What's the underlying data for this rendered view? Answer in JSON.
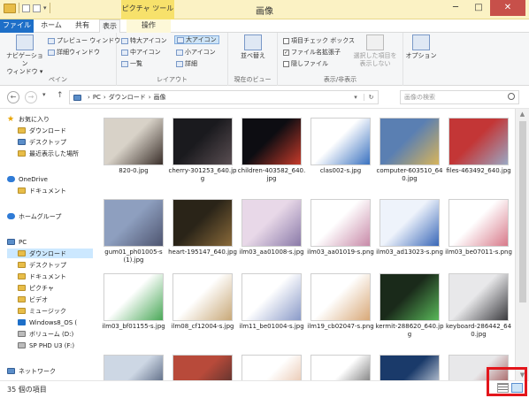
{
  "window": {
    "title": "画像",
    "context_tab_title": "ピクチャ ツール",
    "minimize": "─",
    "maximize": "□",
    "close": "✕"
  },
  "tabs": {
    "file": "ファイル",
    "home": "ホーム",
    "share": "共有",
    "view": "表示",
    "manage": "操作"
  },
  "ribbon": {
    "pane": {
      "navigation_pane": "ナビゲーション",
      "navigation_pane2": "ウィンドウ ▾",
      "preview_pane": "プレビュー ウィンドウ",
      "details_pane": "詳細ウィンドウ",
      "label": "ペイン"
    },
    "layout": {
      "extra_large": "特大アイコン",
      "large": "大アイコン",
      "medium": "中アイコン",
      "small": "小アイコン",
      "list": "一覧",
      "details": "詳細",
      "label": "レイアウト"
    },
    "current_view": {
      "sort": "並べ替え",
      "label": "現在のビュー"
    },
    "show_hide": {
      "item_checkboxes": "項目チェック ボックス",
      "file_extensions": "ファイル名拡張子",
      "hidden_items": "隠しファイル",
      "hide_selected": "選択した項目を",
      "hide_selected2": "表示しない",
      "label": "表示/非表示"
    },
    "options": "オプション"
  },
  "address": {
    "back": "←",
    "forward": "→",
    "history": "▾",
    "up": "↑",
    "crumbs": [
      "PC",
      "ダウンロード",
      "画像"
    ],
    "sep": "›",
    "dropdown": "▾",
    "refresh": "↻",
    "search_placeholder": "画像の検索"
  },
  "nav": {
    "favorites": "お気に入り",
    "downloads": "ダウンロード",
    "desktop": "デスクトップ",
    "recent": "最近表示した場所",
    "onedrive": "OneDrive",
    "documents": "ドキュメント",
    "homegroup": "ホームグループ",
    "pc": "PC",
    "pc_downloads": "ダウンロード",
    "pc_desktop": "デスクトップ",
    "pc_documents": "ドキュメント",
    "pictures": "ピクチャ",
    "videos": "ビデオ",
    "music": "ミュージック",
    "windows8": "Windows8_OS (",
    "volume_d": "ボリューム (D:)",
    "sp_phd": "SP PHD U3 (F:)",
    "network": "ネットワーク"
  },
  "files": [
    {
      "name": "820-0.jpg",
      "colors": [
        "#d8d2c8",
        "#3a2f2a"
      ]
    },
    {
      "name": "cherry-301253_640.jpg",
      "colors": [
        "#1a1a1e",
        "#5a4e52"
      ]
    },
    {
      "name": "children-403582_640.jpg",
      "colors": [
        "#0d0d12",
        "#c63a2a"
      ]
    },
    {
      "name": "clas002-s.jpg",
      "colors": [
        "#ffffff",
        "#3a72c0"
      ]
    },
    {
      "name": "computer-603510_640.jpg",
      "colors": [
        "#5a7fb2",
        "#d8b45a"
      ]
    },
    {
      "name": "files-463492_640.jpg",
      "colors": [
        "#c33636",
        "#9aa8c4"
      ]
    },
    {
      "name": "gum01_ph01005-s (1).jpg",
      "colors": [
        "#8e9fbf",
        "#4e5570"
      ]
    },
    {
      "name": "heart-195147_640.jpg",
      "colors": [
        "#2a2418",
        "#8a6a3a"
      ]
    },
    {
      "name": "ilm03_aa01008-s.jpg",
      "colors": [
        "#e8d8e8",
        "#8a7aa8"
      ]
    },
    {
      "name": "ilm03_aa01019-s.png",
      "colors": [
        "#ffffff",
        "#c88aa8"
      ]
    },
    {
      "name": "ilm03_ad13023-s.png",
      "colors": [
        "#eef3fb",
        "#3a68b8"
      ]
    },
    {
      "name": "ilm03_be07011-s.png",
      "colors": [
        "#ffffff",
        "#d87a8a"
      ]
    },
    {
      "name": "ilm03_bf01155-s.jpg",
      "colors": [
        "#ffffff",
        "#4aa858"
      ]
    },
    {
      "name": "ilm08_cf12004-s.jpg",
      "colors": [
        "#ffffff",
        "#c8a878"
      ]
    },
    {
      "name": "ilm11_be01004-s.jpg",
      "colors": [
        "#ffffff",
        "#8a9ac8"
      ]
    },
    {
      "name": "ilm19_cb02047-s.png",
      "colors": [
        "#ffffff",
        "#d8a878"
      ]
    },
    {
      "name": "kermit-288620_640.jpg",
      "colors": [
        "#1a2a1a",
        "#5ab85a"
      ]
    },
    {
      "name": "keyboard-286442_640.jpg",
      "colors": [
        "#e8e8ea",
        "#3a3a3e"
      ]
    },
    {
      "name": "",
      "colors": [
        "#cdd7e4",
        "#2a3a5a"
      ]
    },
    {
      "name": "",
      "colors": [
        "#b84a3a",
        "#3a2a2a"
      ]
    },
    {
      "name": "",
      "colors": [
        "#ffffff",
        "#e0b090"
      ]
    },
    {
      "name": "",
      "colors": [
        "#ffffff",
        "#444444"
      ]
    },
    {
      "name": "",
      "colors": [
        "#1a3a6a",
        "#ffffff"
      ]
    },
    {
      "name": "",
      "colors": [
        "#e8e8ea",
        "#8a2a2a"
      ]
    }
  ],
  "status": {
    "item_count": "35 個の項目"
  }
}
